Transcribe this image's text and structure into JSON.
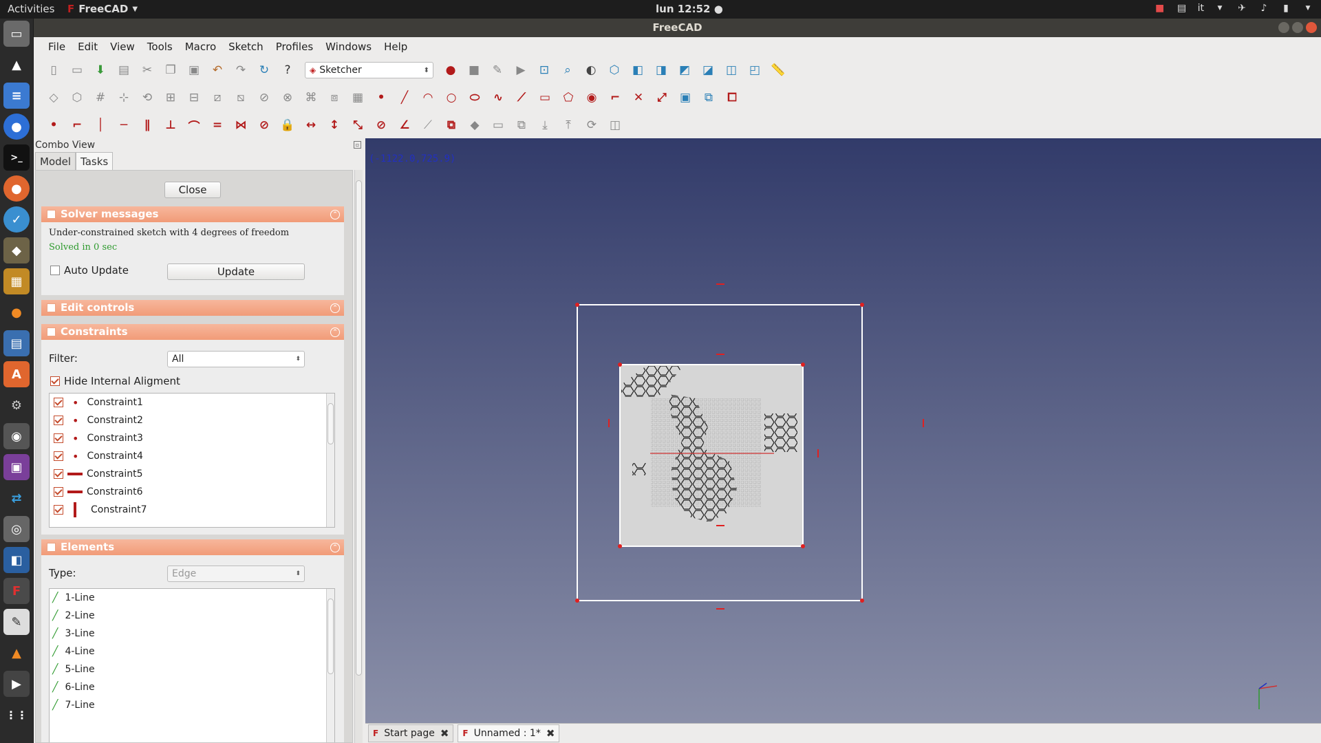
{
  "topbar": {
    "activities": "Activities",
    "app": "FreeCAD",
    "clock": "lun 12:52 ●",
    "lang": "it"
  },
  "window": {
    "title": "FreeCAD"
  },
  "menu": [
    "File",
    "Edit",
    "View",
    "Tools",
    "Macro",
    "Sketch",
    "Profiles",
    "Windows",
    "Help"
  ],
  "workbench": {
    "selected": "Sketcher"
  },
  "combo": {
    "title": "Combo View",
    "tabs": [
      "Model",
      "Tasks"
    ],
    "close_label": "Close",
    "solver": {
      "header": "Solver messages",
      "message": "Under-constrained sketch with 4 degrees of freedom",
      "solved": "Solved in 0 sec",
      "auto_update": "Auto Update",
      "update_label": "Update"
    },
    "edit_controls": {
      "header": "Edit controls"
    },
    "constraints": {
      "header": "Constraints",
      "filter_label": "Filter:",
      "filter_value": "All",
      "hide_internal": "Hide Internal Aligment",
      "items": [
        {
          "name": "Constraint1",
          "icon": "point-on-point-icon"
        },
        {
          "name": "Constraint2",
          "icon": "point-on-point-icon"
        },
        {
          "name": "Constraint3",
          "icon": "point-on-point-icon"
        },
        {
          "name": "Constraint4",
          "icon": "point-on-point-icon"
        },
        {
          "name": "Constraint5",
          "icon": "horizontal-constraint-icon"
        },
        {
          "name": "Constraint6",
          "icon": "horizontal-constraint-icon"
        },
        {
          "name": "Constraint7",
          "icon": "vertical-constraint-icon"
        }
      ]
    },
    "elements": {
      "header": "Elements",
      "type_label": "Type:",
      "type_value": "Edge",
      "items": [
        "1-Line",
        "2-Line",
        "3-Line",
        "4-Line",
        "5-Line",
        "6-Line",
        "7-Line"
      ]
    }
  },
  "view3d": {
    "coordinates": "(-1122.0,725.9)"
  },
  "doc_tabs": [
    {
      "label": "Start page"
    },
    {
      "label": "Unnamed : 1*"
    }
  ],
  "colors": {
    "accent": "#f19b78",
    "constraint": "#b21a1a",
    "solved": "#2e9a2e",
    "coord": "#2230c0"
  }
}
